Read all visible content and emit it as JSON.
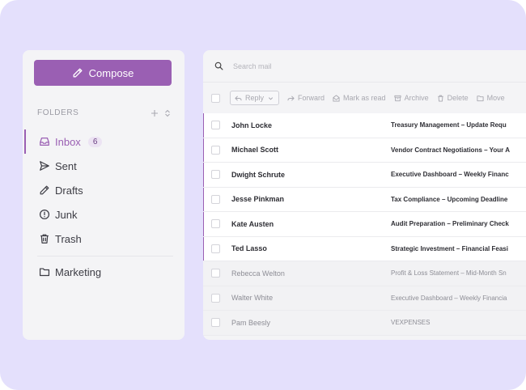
{
  "colors": {
    "accent": "#9a5fb3",
    "background": "#e4e0fc",
    "panel": "#f4f4f6"
  },
  "compose": {
    "label": "Compose",
    "icon": "pencil-icon"
  },
  "folders": {
    "heading": "FOLDERS",
    "items": [
      {
        "label": "Inbox",
        "icon": "inbox-icon",
        "count": "6",
        "active": true
      },
      {
        "label": "Sent",
        "icon": "send-icon"
      },
      {
        "label": "Drafts",
        "icon": "pencil-icon"
      },
      {
        "label": "Junk",
        "icon": "alert-circle-icon"
      },
      {
        "label": "Trash",
        "icon": "trash-icon"
      }
    ],
    "custom": [
      {
        "label": "Marketing",
        "icon": "folder-icon"
      }
    ]
  },
  "search": {
    "placeholder": "Search mail"
  },
  "toolbar": {
    "reply": "Reply",
    "forward": "Forward",
    "mark_as_read": "Mark as read",
    "archive": "Archive",
    "delete": "Delete",
    "move": "Move"
  },
  "emails": [
    {
      "sender": "John Locke",
      "subject": "Treasury Management – Update Requ",
      "unread": true
    },
    {
      "sender": "Michael Scott",
      "subject": "Vendor Contract Negotiations – Your A",
      "unread": true
    },
    {
      "sender": "Dwight Schrute",
      "subject": "Executive Dashboard – Weekly Financ",
      "unread": true
    },
    {
      "sender": "Jesse Pinkman",
      "subject": "Tax Compliance – Upcoming Deadline",
      "unread": true
    },
    {
      "sender": "Kate Austen",
      "subject": "Audit Preparation – Preliminary Check",
      "unread": true
    },
    {
      "sender": "Ted Lasso",
      "subject": "Strategic Investment – Financial Feasi",
      "unread": true
    },
    {
      "sender": "Rebecca Welton",
      "subject": "Profit & Loss Statement – Mid-Month Sn",
      "unread": false
    },
    {
      "sender": "Walter White",
      "subject": "Executive Dashboard – Weekly Financia",
      "unread": false
    },
    {
      "sender": "Pam Beesly",
      "subject": "VEXPENSES",
      "unread": false
    }
  ]
}
